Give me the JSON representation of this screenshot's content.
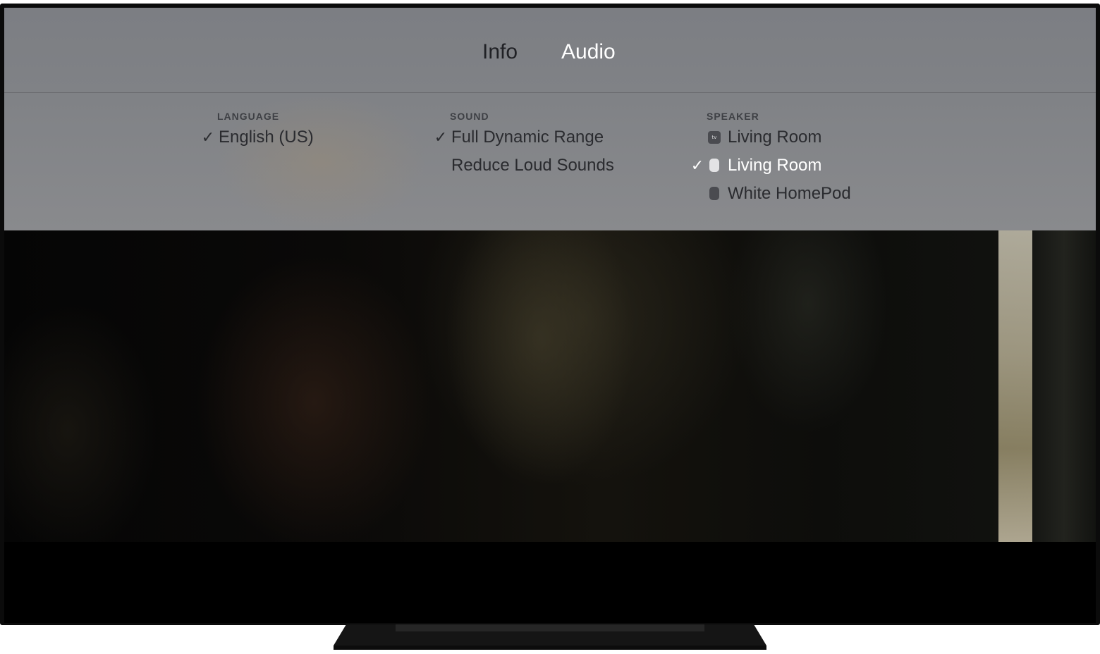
{
  "tabs": [
    {
      "label": "Info",
      "active": false
    },
    {
      "label": "Audio",
      "active": true
    }
  ],
  "columns": {
    "language": {
      "header": "LANGUAGE",
      "items": [
        {
          "label": "English (US)",
          "checked": true
        }
      ]
    },
    "sound": {
      "header": "SOUND",
      "items": [
        {
          "label": "Full Dynamic Range",
          "checked": true
        },
        {
          "label": "Reduce Loud Sounds",
          "checked": false
        }
      ]
    },
    "speaker": {
      "header": "SPEAKER",
      "items": [
        {
          "label": "Living Room",
          "checked": false,
          "icon": "apple-tv-icon",
          "icon_text": "tv"
        },
        {
          "label": "Living Room",
          "checked": true,
          "focused": true,
          "icon": "homepod-icon"
        },
        {
          "label": "White HomePod",
          "checked": false,
          "icon": "homepod-icon"
        }
      ]
    }
  },
  "check_glyph": "✓",
  "colors": {
    "overlay": "#808286",
    "text_dark": "#2a2b2f",
    "text_focused": "#ffffff"
  }
}
